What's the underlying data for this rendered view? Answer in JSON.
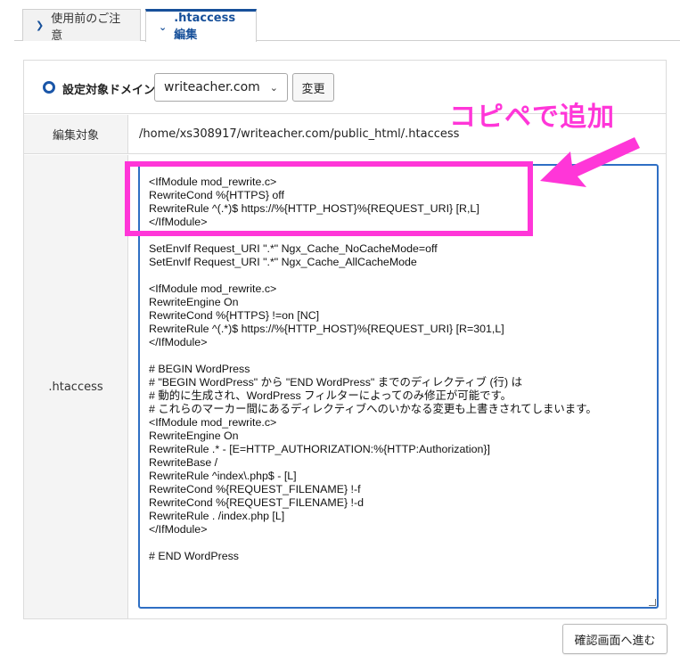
{
  "tabs": [
    {
      "label": "使用前のご注意",
      "active": false
    },
    {
      "label": ".htaccess編集",
      "active": true
    }
  ],
  "domain_row": {
    "label": "設定対象ドメイン",
    "selected_domain": "writeacher.com",
    "change_button": "変更"
  },
  "target_row": {
    "label": "編集対象",
    "value": "/home/xs308917/writeacher.com/public_html/.htaccess"
  },
  "editor_row": {
    "label": ".htaccess"
  },
  "editor_lines": [
    "<IfModule mod_rewrite.c>",
    "RewriteCond %{HTTPS} off",
    "RewriteRule ^(.*)$ https://%{HTTP_HOST}%{REQUEST_URI} [R,L]",
    "</IfModule>",
    "",
    "SetEnvIf Request_URI \".*\" Ngx_Cache_NoCacheMode=off",
    "SetEnvIf Request_URI \".*\" Ngx_Cache_AllCacheMode",
    "",
    "<IfModule mod_rewrite.c>",
    "RewriteEngine On",
    "RewriteCond %{HTTPS} !=on [NC]",
    "RewriteRule ^(.*)$ https://%{HTTP_HOST}%{REQUEST_URI} [R=301,L]",
    "</IfModule>",
    "",
    "# BEGIN WordPress",
    "# \"BEGIN WordPress\" から \"END WordPress\" までのディレクティブ (行) は",
    "# 動的に生成され、WordPress フィルターによってのみ修正が可能です。",
    "# これらのマーカー間にあるディレクティブへのいかなる変更も上書きされてしまいます。",
    "<IfModule mod_rewrite.c>",
    "RewriteEngine On",
    "RewriteRule .* - [E=HTTP_AUTHORIZATION:%{HTTP:Authorization}]",
    "RewriteBase /",
    "RewriteRule ^index\\.php$ - [L]",
    "RewriteCond %{REQUEST_FILENAME} !-f",
    "RewriteCond %{REQUEST_FILENAME} !-d",
    "RewriteRule . /index.php [L]",
    "</IfModule>",
    "",
    "# END WordPress"
  ],
  "confirm_button": "確認画面へ進む",
  "annotation": {
    "text": "コピペで追加",
    "color": "#ff36d8"
  },
  "colors": {
    "accent": "#17509a",
    "editor_border": "#2f6fc4"
  },
  "icons": {
    "tab_usage": "chevron-right-icon",
    "tab_htaccess": "chevron-down-icon",
    "select": "chevron-down-icon",
    "radio": "radio-selected-icon"
  }
}
